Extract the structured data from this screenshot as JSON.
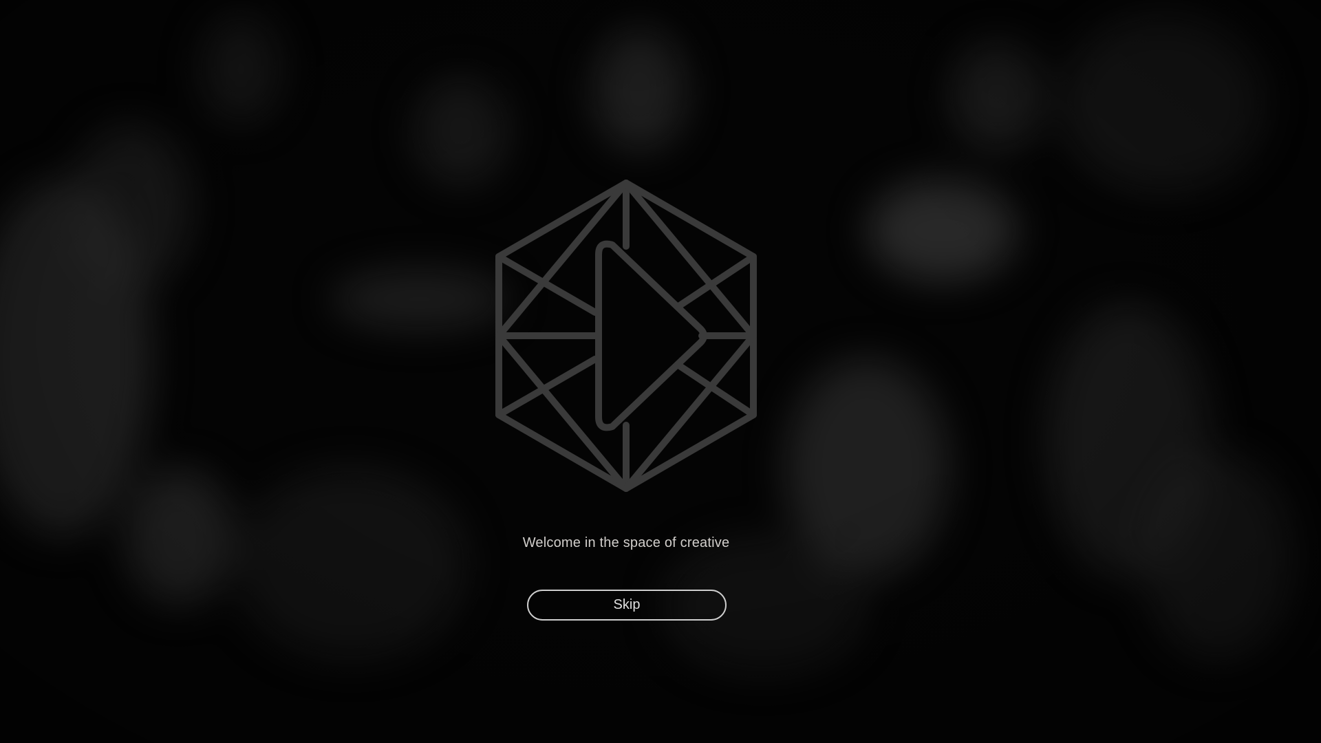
{
  "splash": {
    "logo_icon": "hexagon-play-icon",
    "tagline": "Welcome in the space of creative",
    "skip_label": "Skip"
  },
  "colors": {
    "background": "#050505",
    "logo_stroke": "#3a3a3a",
    "text": "#d2cfcc",
    "button_border": "#cfcfcf"
  }
}
